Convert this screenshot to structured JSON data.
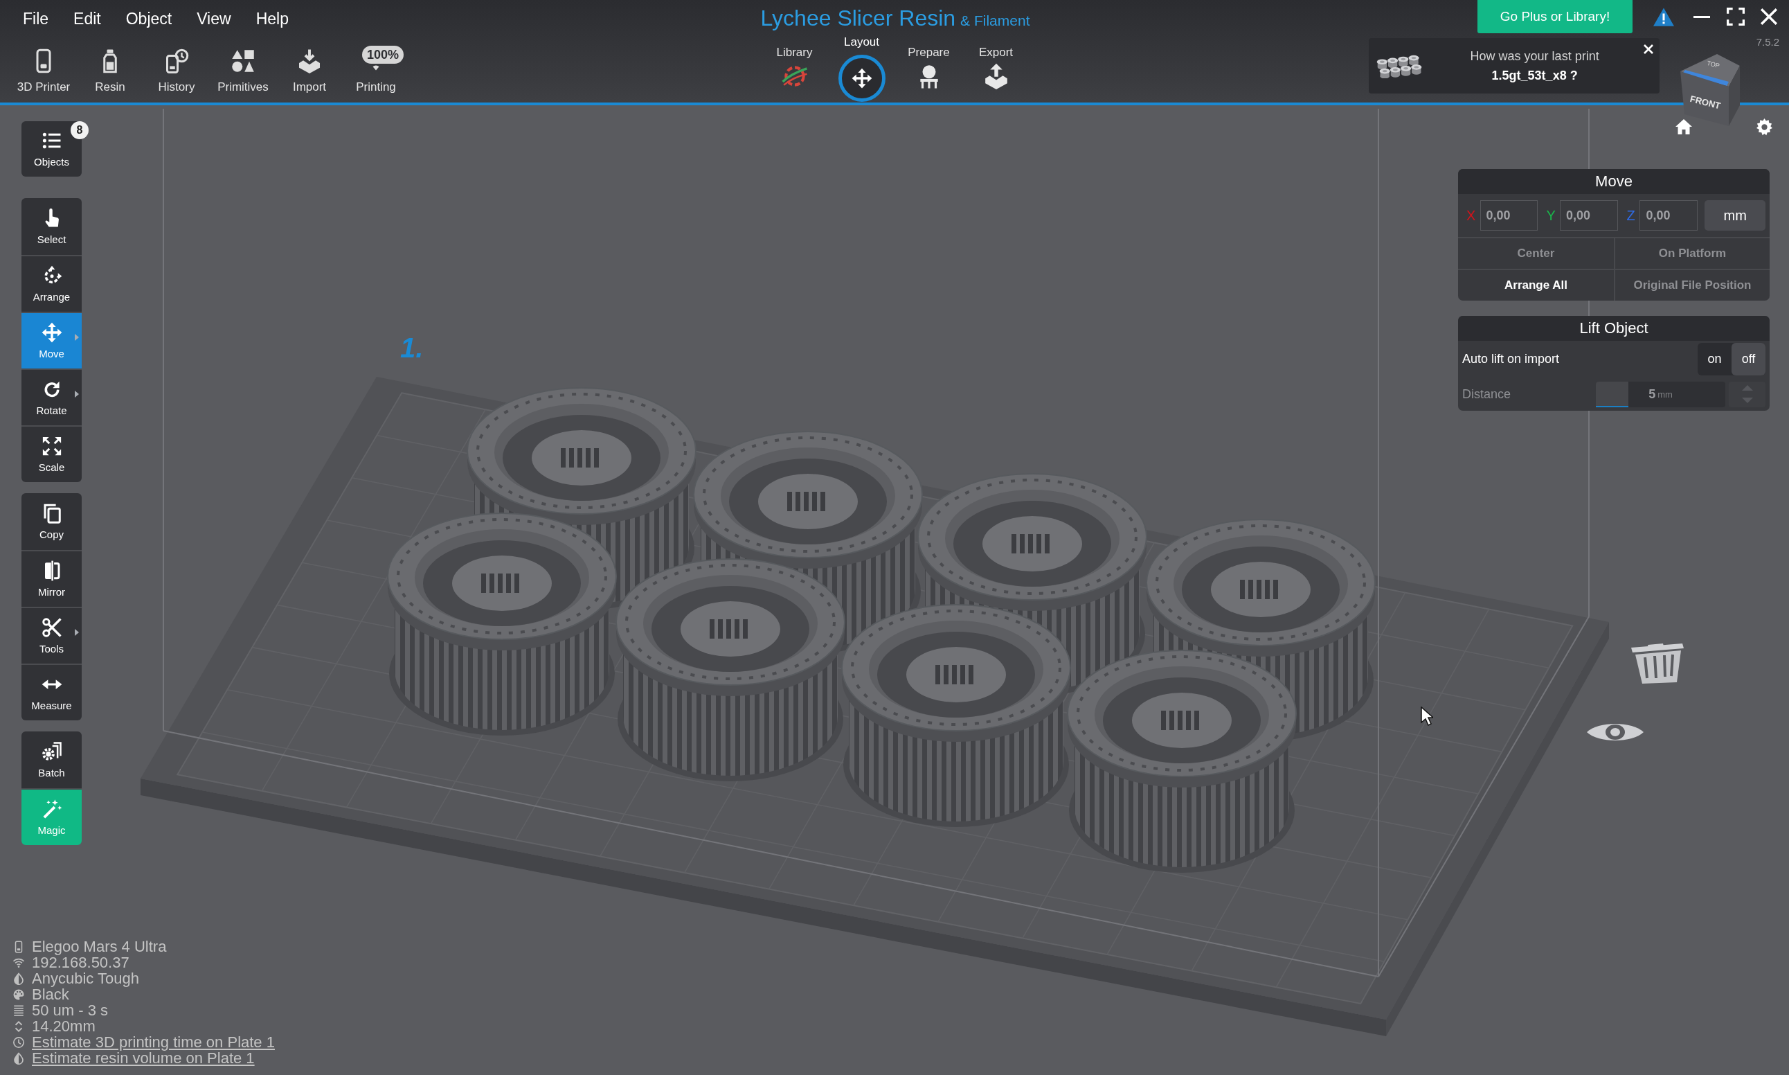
{
  "menu": [
    "File",
    "Edit",
    "Object",
    "View",
    "Help"
  ],
  "toolbar": [
    {
      "kind": "printer",
      "label": "3D Printer"
    },
    {
      "kind": "resin",
      "label": "Resin"
    },
    {
      "kind": "history",
      "label": "History"
    },
    {
      "kind": "primitives",
      "label": "Primitives"
    },
    {
      "kind": "import",
      "label": "Import"
    },
    {
      "kind": "printing",
      "label": "Printing",
      "badge": "100%"
    }
  ],
  "title": {
    "name": "Lychee Slicer Resin",
    "edition": "& Filament"
  },
  "modes": [
    {
      "kind": "library",
      "label": "Library",
      "selected": false
    },
    {
      "kind": "layout",
      "label": "Layout",
      "selected": true
    },
    {
      "kind": "prepare",
      "label": "Prepare",
      "selected": false
    },
    {
      "kind": "export",
      "label": "Export",
      "selected": false
    }
  ],
  "upgrade_button": "Go Plus or Library!",
  "version": "7.5.2",
  "feedback": {
    "question": "How was your last print",
    "file": "1.5gt_53t_x8 ?"
  },
  "view_cube": {
    "top": "TOP",
    "front": "FRONT"
  },
  "tools": [
    {
      "items": [
        {
          "kind": "objects",
          "label": "Objects",
          "badge": "8",
          "selected": false,
          "submenu": false
        }
      ]
    },
    {
      "items": [
        {
          "kind": "select",
          "label": "Select",
          "selected": false,
          "submenu": false
        },
        {
          "kind": "arrange",
          "label": "Arrange",
          "selected": false,
          "submenu": false
        },
        {
          "kind": "move",
          "label": "Move",
          "selected": true,
          "submenu": true
        },
        {
          "kind": "rotate",
          "label": "Rotate",
          "selected": false,
          "submenu": true
        },
        {
          "kind": "scale",
          "label": "Scale",
          "selected": false,
          "submenu": false
        }
      ]
    },
    {
      "items": [
        {
          "kind": "copy",
          "label": "Copy",
          "selected": false,
          "submenu": false
        },
        {
          "kind": "mirror",
          "label": "Mirror",
          "selected": false,
          "submenu": false
        },
        {
          "kind": "tools",
          "label": "Tools",
          "selected": false,
          "submenu": true
        },
        {
          "kind": "measure",
          "label": "Measure",
          "selected": false,
          "submenu": false
        }
      ]
    },
    {
      "items": [
        {
          "kind": "batch",
          "label": "Batch",
          "selected": false,
          "submenu": false
        },
        {
          "kind": "magic",
          "label": "Magic",
          "selected": false,
          "submenu": false
        }
      ]
    }
  ],
  "plate_label": "1.",
  "move_panel": {
    "title": "Move",
    "axes": [
      {
        "axis": "X",
        "value": "0,00",
        "color": "#d0141c"
      },
      {
        "axis": "Y",
        "value": "0,00",
        "color": "#19b84b"
      },
      {
        "axis": "Z",
        "value": "0,00",
        "color": "#2f6be6"
      }
    ],
    "unit": "mm",
    "actions": [
      {
        "label": "Center",
        "disabled": true
      },
      {
        "label": "On Platform",
        "disabled": true
      },
      {
        "label": "Arrange All",
        "disabled": false
      },
      {
        "label": "Original File Position",
        "disabled": true
      }
    ]
  },
  "lift_panel": {
    "title": "Lift Object",
    "auto_lift": {
      "label": "Auto lift on import",
      "options": [
        {
          "label": "on",
          "selected": false
        },
        {
          "label": "off",
          "selected": true
        }
      ]
    },
    "distance": {
      "label": "Distance",
      "value": "5",
      "unit": "mm",
      "level": 0.25,
      "disabled": true
    }
  },
  "printer_info": [
    {
      "kind": "printer",
      "text": "Elegoo Mars 4 Ultra",
      "link": false
    },
    {
      "kind": "wifi",
      "text": "192.168.50.37",
      "link": false
    },
    {
      "kind": "resin",
      "text": "Anycubic Tough",
      "link": false
    },
    {
      "kind": "color",
      "text": "Black",
      "link": false
    },
    {
      "kind": "layers",
      "text": "50 um - 3 s",
      "link": false
    },
    {
      "kind": "height",
      "text": "14.20mm",
      "link": false
    },
    {
      "kind": "time",
      "text": "Estimate 3D printing time on Plate 1",
      "link": true
    },
    {
      "kind": "resin",
      "text": "Estimate resin volume on Plate 1",
      "link": true
    }
  ]
}
